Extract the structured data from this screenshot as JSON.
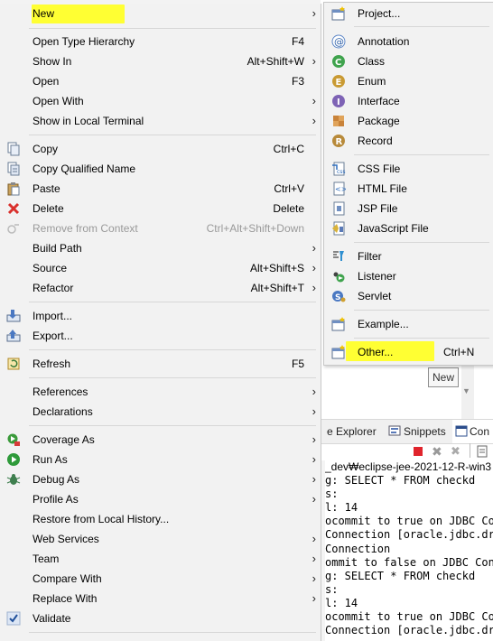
{
  "context_menu": {
    "items": [
      {
        "label": "New",
        "accel": "",
        "submenu": true,
        "highlighted": true,
        "icon": ""
      },
      {
        "label": "Open Type Hierarchy",
        "accel": "F4",
        "submenu": false,
        "icon": ""
      },
      {
        "label": "Show In",
        "accel": "Alt+Shift+W",
        "submenu": true,
        "icon": ""
      },
      {
        "label": "Open",
        "accel": "F3",
        "submenu": false,
        "icon": ""
      },
      {
        "label": "Open With",
        "accel": "",
        "submenu": true,
        "icon": ""
      },
      {
        "label": "Show in Local Terminal",
        "accel": "",
        "submenu": true,
        "icon": ""
      },
      {
        "label": "Copy",
        "accel": "Ctrl+C",
        "submenu": false,
        "icon": "copy-icon"
      },
      {
        "label": "Copy Qualified Name",
        "accel": "",
        "submenu": false,
        "icon": "copy-qualified-icon"
      },
      {
        "label": "Paste",
        "accel": "Ctrl+V",
        "submenu": false,
        "icon": "paste-icon"
      },
      {
        "label": "Delete",
        "accel": "Delete",
        "submenu": false,
        "icon": "delete-icon"
      },
      {
        "label": "Remove from Context",
        "accel": "Ctrl+Alt+Shift+Down",
        "submenu": false,
        "disabled": true,
        "icon": "remove-context-icon"
      },
      {
        "label": "Build Path",
        "accel": "",
        "submenu": true,
        "icon": ""
      },
      {
        "label": "Source",
        "accel": "Alt+Shift+S",
        "submenu": true,
        "icon": ""
      },
      {
        "label": "Refactor",
        "accel": "Alt+Shift+T",
        "submenu": true,
        "icon": ""
      },
      {
        "label": "Import...",
        "accel": "",
        "submenu": false,
        "icon": "import-icon"
      },
      {
        "label": "Export...",
        "accel": "",
        "submenu": false,
        "icon": "export-icon"
      },
      {
        "label": "Refresh",
        "accel": "F5",
        "submenu": false,
        "icon": "refresh-icon"
      },
      {
        "label": "References",
        "accel": "",
        "submenu": true,
        "icon": ""
      },
      {
        "label": "Declarations",
        "accel": "",
        "submenu": true,
        "icon": ""
      },
      {
        "label": "Coverage As",
        "accel": "",
        "submenu": true,
        "icon": "coverage-icon"
      },
      {
        "label": "Run As",
        "accel": "",
        "submenu": true,
        "icon": "run-icon"
      },
      {
        "label": "Debug As",
        "accel": "",
        "submenu": true,
        "icon": "debug-icon"
      },
      {
        "label": "Profile As",
        "accel": "",
        "submenu": true,
        "icon": ""
      },
      {
        "label": "Restore from Local History...",
        "accel": "",
        "submenu": false,
        "icon": ""
      },
      {
        "label": "Web Services",
        "accel": "",
        "submenu": true,
        "icon": ""
      },
      {
        "label": "Team",
        "accel": "",
        "submenu": true,
        "icon": ""
      },
      {
        "label": "Compare With",
        "accel": "",
        "submenu": true,
        "icon": ""
      },
      {
        "label": "Replace With",
        "accel": "",
        "submenu": true,
        "icon": ""
      },
      {
        "label": "Validate",
        "accel": "",
        "submenu": false,
        "checked": true,
        "icon": "check-icon"
      }
    ]
  },
  "submenu_new": {
    "items": [
      {
        "label": "Project...",
        "accel": "",
        "icon": "project-icon"
      },
      {
        "label": "Annotation",
        "accel": "",
        "icon": "annotation-icon"
      },
      {
        "label": "Class",
        "accel": "",
        "icon": "class-icon"
      },
      {
        "label": "Enum",
        "accel": "",
        "icon": "enum-icon"
      },
      {
        "label": "Interface",
        "accel": "",
        "icon": "interface-icon"
      },
      {
        "label": "Package",
        "accel": "",
        "icon": "package-icon"
      },
      {
        "label": "Record",
        "accel": "",
        "icon": "record-icon"
      },
      {
        "label": "CSS File",
        "accel": "",
        "icon": "css-file-icon"
      },
      {
        "label": "HTML File",
        "accel": "",
        "icon": "html-file-icon"
      },
      {
        "label": "JSP File",
        "accel": "",
        "icon": "jsp-file-icon"
      },
      {
        "label": "JavaScript File",
        "accel": "",
        "icon": "javascript-file-icon"
      },
      {
        "label": "Filter",
        "accel": "",
        "icon": "filter-icon"
      },
      {
        "label": "Listener",
        "accel": "",
        "icon": "listener-icon"
      },
      {
        "label": "Servlet",
        "accel": "",
        "icon": "servlet-icon"
      },
      {
        "label": "Example...",
        "accel": "",
        "icon": "example-icon"
      },
      {
        "label": "Other...",
        "accel": "Ctrl+N",
        "icon": "other-icon",
        "highlighted": true
      }
    ]
  },
  "tooltip": {
    "text": "New"
  },
  "ide": {
    "tabs": [
      {
        "label": "e Explorer",
        "icon": ""
      },
      {
        "label": "Snippets",
        "icon": "snippets-icon"
      },
      {
        "label": "Con",
        "icon": "console-icon"
      }
    ],
    "console_path": "_dev₩eclipse-jee-2021-12-R-win3",
    "console_lines": [
      "g: SELECT * FROM checkd",
      "s:",
      "l: 14",
      "ocommit to true on JDBC Co",
      "Connection [oracle.jdbc.dr",
      "Connection",
      "ommit to false on JDBC Con",
      "g: SELECT * FROM checkd",
      "s:",
      "l: 14",
      "ocommit to true on JDBC Co",
      "Connection [oracle.jdbc.dr"
    ]
  },
  "colors": {
    "highlight": "#ffff33",
    "menu_bg": "#f2f2f2",
    "disabled": "#9a9a9a"
  }
}
